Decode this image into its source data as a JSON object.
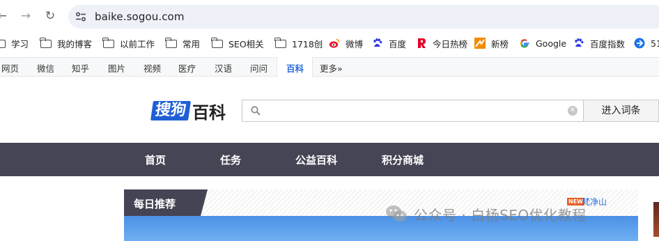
{
  "browser": {
    "url": "baike.sogou.com",
    "bookmarks": [
      {
        "label": "学习",
        "icon": "folder-icon"
      },
      {
        "label": "我的博客",
        "icon": "folder-icon"
      },
      {
        "label": "以前工作",
        "icon": "folder-icon"
      },
      {
        "label": "常用",
        "icon": "folder-icon"
      },
      {
        "label": "SEO相关",
        "icon": "folder-icon"
      },
      {
        "label": "1718创",
        "icon": "folder-icon"
      },
      {
        "label": "微博",
        "icon": "weibo-icon"
      },
      {
        "label": "百度",
        "icon": "baidu-paw-icon"
      },
      {
        "label": "今日热榜",
        "icon": "rebang-icon"
      },
      {
        "label": "新榜",
        "icon": "xinbang-icon"
      },
      {
        "label": "Google",
        "icon": "google-icon"
      },
      {
        "label": "百度指数",
        "icon": "baidu-paw-icon"
      },
      {
        "label": "51",
        "icon": "site-icon"
      }
    ]
  },
  "channels": [
    "网页",
    "微信",
    "知乎",
    "图片",
    "视频",
    "医疗",
    "汉语",
    "问问",
    "百科",
    "更多»"
  ],
  "active_channel": "百科",
  "logo": {
    "blue_part": "搜狗",
    "dark_part": "百科"
  },
  "search": {
    "value": "",
    "button_label": "进入词条"
  },
  "main_nav": [
    "首页",
    "任务",
    "公益百科",
    "积分商城"
  ],
  "daily": {
    "title": "每日推荐",
    "badge": "NEW",
    "link": "梵净山"
  },
  "watermark": "公众号 · 白杨SEO优化教程",
  "colors": {
    "nav_bg": "#464556",
    "logo_blue": "#1f5fd6",
    "active_channel": "#2a6bd8"
  }
}
